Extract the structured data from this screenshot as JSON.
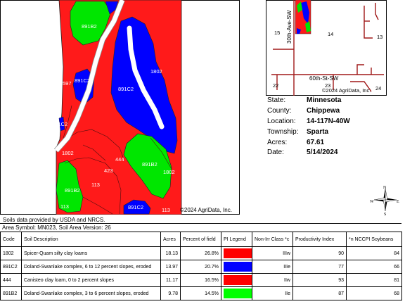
{
  "map": {
    "unit_labels": [
      "891B2",
      "597",
      "891C2",
      "891C2",
      "1802",
      "891C2",
      "1802",
      "444",
      "423",
      "891B2",
      "1802",
      "113",
      "891B2",
      "113",
      "891C2",
      "113"
    ],
    "copyright": "©2024 AgriData, Inc."
  },
  "locator": {
    "roads": [
      "30th-Ave-SW",
      "60th-St-SW"
    ],
    "sections": [
      "15",
      "14",
      "13",
      "22",
      "23",
      "24"
    ],
    "copyright": "©2024 AgriData, Inc."
  },
  "site_info": [
    {
      "label": "State:",
      "value": "Minnesota"
    },
    {
      "label": "County:",
      "value": "Chippewa"
    },
    {
      "label": "Location:",
      "value": "14-117N-40W"
    },
    {
      "label": "Township:",
      "value": "Sparta"
    },
    {
      "label": "Acres:",
      "value": "67.61"
    },
    {
      "label": "Date:",
      "value": "5/14/2024"
    }
  ],
  "compass": {
    "n": "N",
    "s": "S",
    "e": "E",
    "w": "W"
  },
  "source_note": "Soils data provided by USDA and NRCS.",
  "area_symbol": "Area Symbol: MN023, Soil Area Version: 26",
  "table": {
    "headers": [
      "Code",
      "Soil Description",
      "Acres",
      "Percent of field",
      "PI Legend",
      "Non-Irr Class *c",
      "Productivity Index",
      "*n NCCPI Soybeans"
    ],
    "rows": [
      {
        "code": "1802",
        "description": "Spicer-Quam silty clay loams",
        "acres": "18.13",
        "percent": "26.8%",
        "legend_color": "#ff0000",
        "class": "IIIw",
        "pi": "90",
        "nccpi": "84"
      },
      {
        "code": "891C2",
        "description": "Doland-Swanlake complex, 6 to 12 percent slopes, eroded",
        "acres": "13.97",
        "percent": "20.7%",
        "legend_color": "#0000ff",
        "class": "IIIe",
        "pi": "77",
        "nccpi": "66"
      },
      {
        "code": "444",
        "description": "Canisteo clay loam, 0 to 2 percent slopes",
        "acres": "11.17",
        "percent": "16.5%",
        "legend_color": "#ff0000",
        "class": "IIw",
        "pi": "93",
        "nccpi": "81"
      },
      {
        "code": "891B2",
        "description": "Doland-Swanlake complex, 3 to 6 percent slopes, eroded",
        "acres": "9.78",
        "percent": "14.5%",
        "legend_color": "#00ff00",
        "class": "IIe",
        "pi": "87",
        "nccpi": "68"
      }
    ]
  }
}
